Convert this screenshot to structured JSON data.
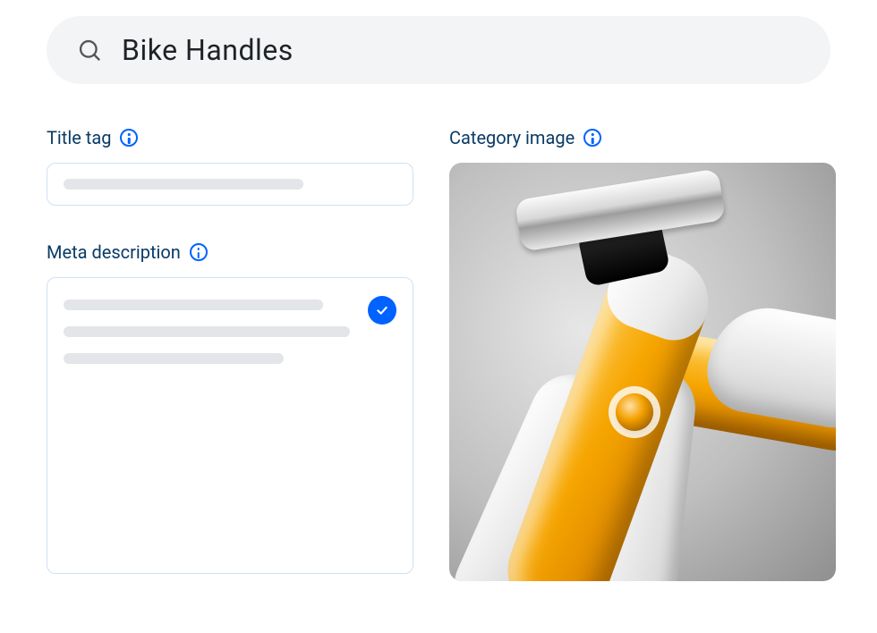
{
  "search": {
    "query": "Bike Handles"
  },
  "fields": {
    "title_tag": {
      "label": "Title tag"
    },
    "meta_description": {
      "label": "Meta description"
    },
    "category_image": {
      "label": "Category image"
    }
  },
  "icons": {
    "search": "search-icon",
    "info": "info-icon",
    "check": "check-icon"
  },
  "colors": {
    "accent": "#0062ff",
    "label_text": "#0a3b66",
    "search_bg": "#f3f4f6",
    "placeholder": "#e3e5e8",
    "box_border": "#cfe1f5"
  }
}
